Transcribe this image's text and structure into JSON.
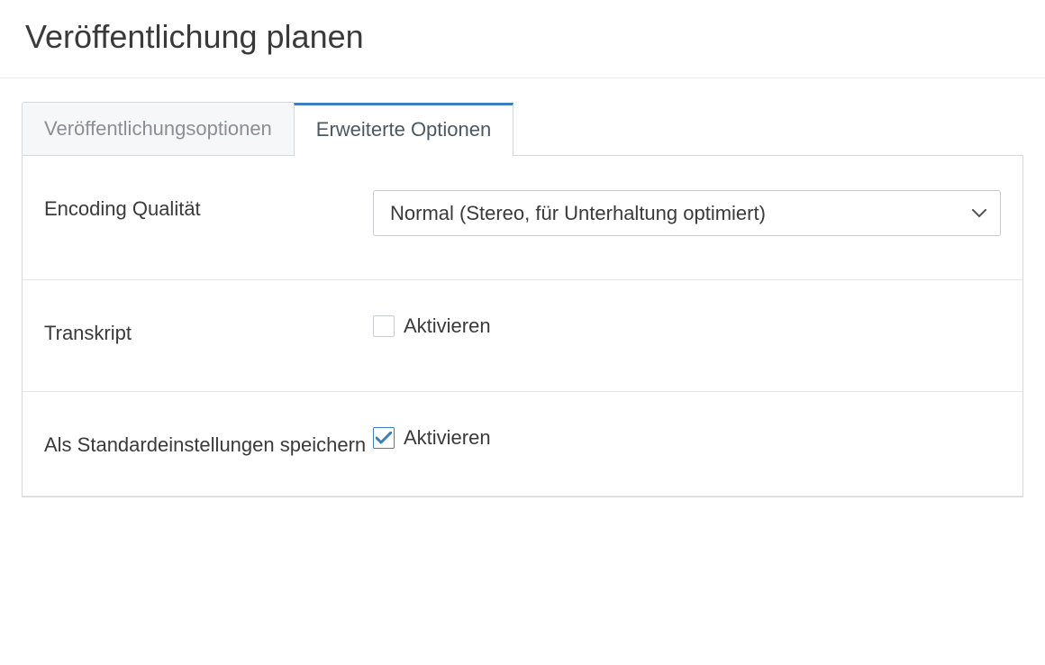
{
  "header": {
    "title": "Veröffentlichung planen"
  },
  "tabs": [
    {
      "label": "Veröffentlichungsoptionen",
      "active": false
    },
    {
      "label": "Erweiterte Optionen",
      "active": true
    }
  ],
  "form": {
    "encoding": {
      "label": "Encoding Qualität",
      "selected": "Normal (Stereo, für Unterhaltung optimiert)"
    },
    "transcript": {
      "label": "Transkript",
      "checkbox_label": "Aktivieren",
      "checked": false
    },
    "default_settings": {
      "label": "Als Standardeinstellungen speichern",
      "checkbox_label": "Aktivieren",
      "checked": true
    }
  }
}
